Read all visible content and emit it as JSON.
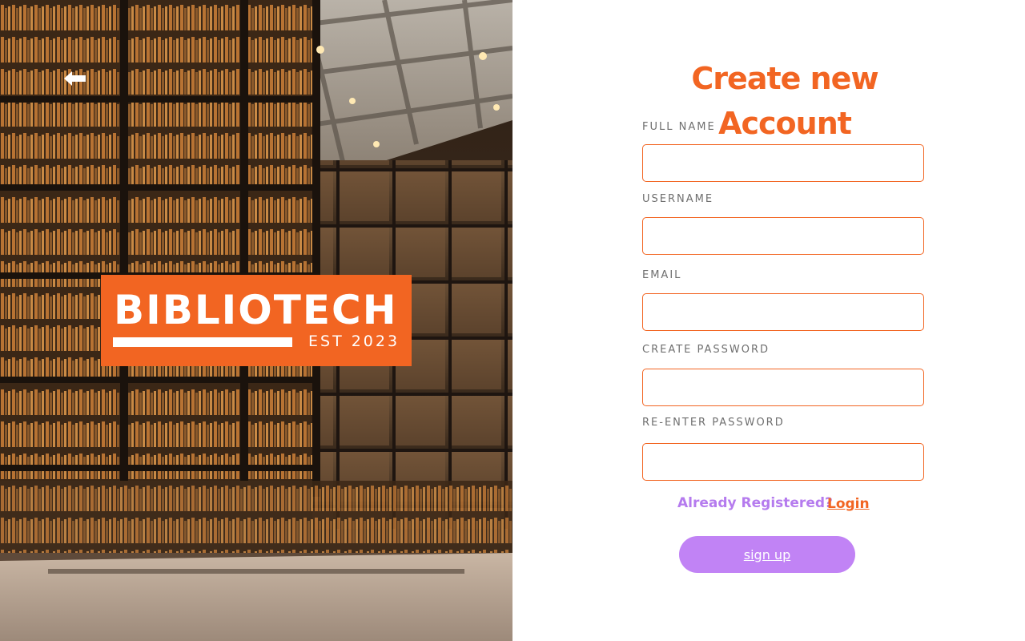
{
  "hero": {
    "back_icon": "arrow-left-icon",
    "logo": {
      "title": "BIBLIOTECH",
      "subtitle": "EST 2023",
      "background": "#f26522"
    }
  },
  "form": {
    "title": "Create new Account",
    "fields": [
      {
        "label": "FULL NAME",
        "value": "",
        "placeholder": ""
      },
      {
        "label": "USERNAME",
        "value": "",
        "placeholder": ""
      },
      {
        "label": "EMAIL",
        "value": "",
        "placeholder": ""
      },
      {
        "label": "CREATE PASSWORD",
        "value": "",
        "placeholder": ""
      },
      {
        "label": "RE-ENTER PASSWORD",
        "value": "",
        "placeholder": ""
      }
    ],
    "already_registered": "Already Registered?",
    "login_label": "Login",
    "signup_label": "sign up"
  },
  "colors": {
    "accent": "#f26522",
    "purple_text": "#b57bee",
    "button": "#c183f5",
    "label_gray": "#6f6f6f"
  }
}
